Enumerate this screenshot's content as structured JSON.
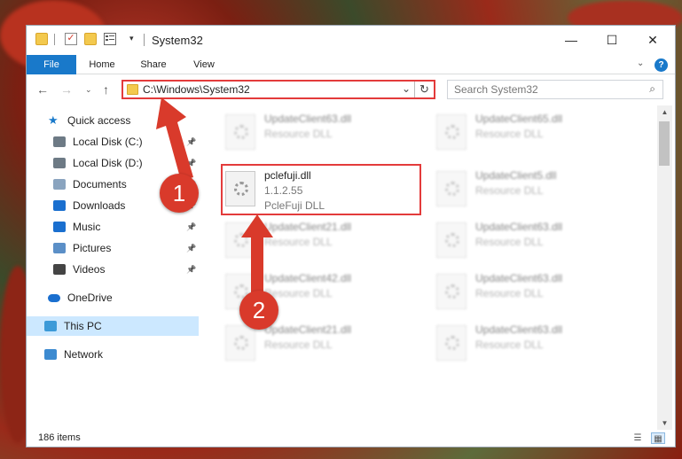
{
  "window": {
    "title": "System32"
  },
  "window_controls": {
    "minimize": "—",
    "maximize": "☐",
    "close": "✕"
  },
  "ribbon": {
    "tabs": [
      "File",
      "Home",
      "Share",
      "View"
    ],
    "help": "?"
  },
  "nav": {
    "address": "C:\\Windows\\System32",
    "search_placeholder": "Search System32"
  },
  "sidebar": {
    "items": [
      {
        "label": "Quick access",
        "icon": "star-icon",
        "color": "#1979ca",
        "pinned": false
      },
      {
        "label": "Local Disk (C:)",
        "icon": "drive-icon",
        "color": "#6d7a85",
        "pinned": true
      },
      {
        "label": "Local Disk (D:)",
        "icon": "drive-icon",
        "color": "#6d7a85",
        "pinned": true
      },
      {
        "label": "Documents",
        "icon": "documents-icon",
        "color": "#8aa4bf",
        "pinned": true
      },
      {
        "label": "Downloads",
        "icon": "download-icon",
        "color": "#1a6fcf",
        "pinned": true
      },
      {
        "label": "Music",
        "icon": "music-icon",
        "color": "#1a6fcf",
        "pinned": true
      },
      {
        "label": "Pictures",
        "icon": "pictures-icon",
        "color": "#5b8fc7",
        "pinned": true
      },
      {
        "label": "Videos",
        "icon": "videos-icon",
        "color": "#444444",
        "pinned": true
      },
      {
        "label": "OneDrive",
        "icon": "cloud-icon",
        "color": "#1a6fcf",
        "pinned": false
      },
      {
        "label": "This PC",
        "icon": "computer-icon",
        "color": "#3c9ad8",
        "pinned": false
      },
      {
        "label": "Network",
        "icon": "network-icon",
        "color": "#3c8ad0",
        "pinned": false
      }
    ]
  },
  "files": [
    {
      "name": "UpdateClient63.dll",
      "desc": "Resource DLL",
      "version": "",
      "blurred": true
    },
    {
      "name": "UpdateClient65.dll",
      "desc": "Resource DLL",
      "version": "",
      "blurred": true
    },
    {
      "name": "pclefuji.dll",
      "version": "1.1.2.55",
      "desc": "PcleFuji DLL",
      "blurred": false
    },
    {
      "name": "UpdateClient5.dll",
      "desc": "Resource DLL",
      "version": "",
      "blurred": true
    },
    {
      "name": "UpdateClient21.dll",
      "desc": "Resource DLL",
      "version": "",
      "blurred": true
    },
    {
      "name": "UpdateClient63.dll",
      "desc": "Resource DLL",
      "version": "",
      "blurred": true
    },
    {
      "name": "UpdateClient42.dll",
      "desc": "Resource DLL",
      "version": "",
      "blurred": true
    },
    {
      "name": "UpdateClient63.dll",
      "desc": "Resource DLL",
      "version": "",
      "blurred": true
    },
    {
      "name": "UpdateClient21.dll",
      "desc": "Resource DLL",
      "version": "",
      "blurred": true
    },
    {
      "name": "UpdateClient63.dll",
      "desc": "Resource DLL",
      "version": "",
      "blurred": true
    }
  ],
  "status": {
    "items_count": "186 items"
  },
  "annotations": {
    "step1": "1",
    "step2": "2",
    "color": "#d93a2b"
  }
}
